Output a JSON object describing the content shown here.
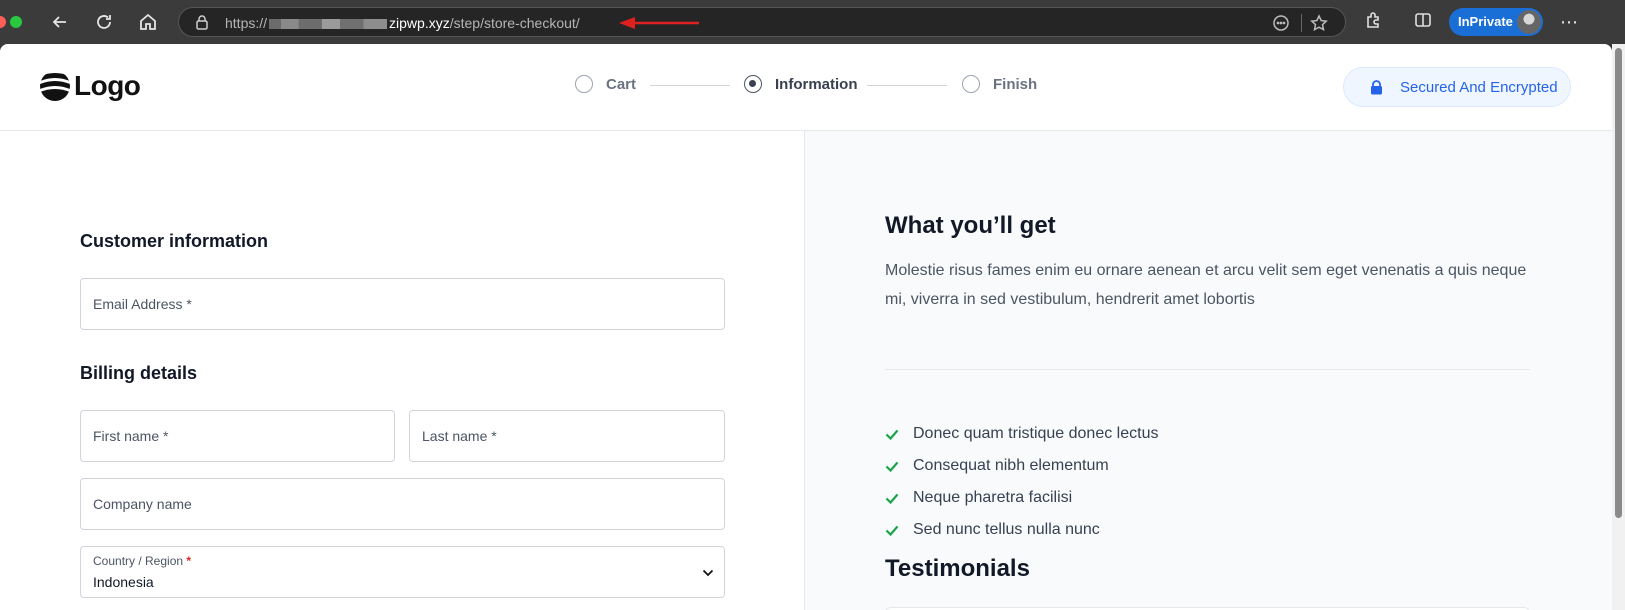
{
  "browser": {
    "url_prefix": "https://",
    "url_domain": "zipwp.xyz",
    "url_path": "/step/store-checkout/",
    "inprivate_label": "InPrivate",
    "annotation_color": "#e02020"
  },
  "header": {
    "logo_text": "Logo",
    "steps": [
      {
        "label": "Cart",
        "state": "inactive"
      },
      {
        "label": "Information",
        "state": "active"
      },
      {
        "label": "Finish",
        "state": "inactive"
      }
    ],
    "secured_label": "Secured And Encrypted",
    "accent_color": "#2563eb"
  },
  "form": {
    "customer_title": "Customer information",
    "email_placeholder": "Email Address *",
    "billing_title": "Billing details",
    "first_name_placeholder": "First name *",
    "last_name_placeholder": "Last name *",
    "company_placeholder": "Company name",
    "country_label": "Country / Region",
    "country_required_mark": "*",
    "country_value": "Indonesia"
  },
  "sidebar": {
    "title": "What you’ll get",
    "description": "Molestie risus fames enim eu ornare aenean et arcu velit sem eget venenatis a quis neque mi, viverra in sed vestibulum, hendrerit amet lobortis",
    "benefits": [
      "Donec quam tristique donec lectus",
      "Consequat nibh elementum",
      "Neque pharetra facilisi",
      "Sed nunc tellus nulla nunc"
    ],
    "check_color": "#16a34a",
    "testimonials_title": "Testimonials"
  }
}
